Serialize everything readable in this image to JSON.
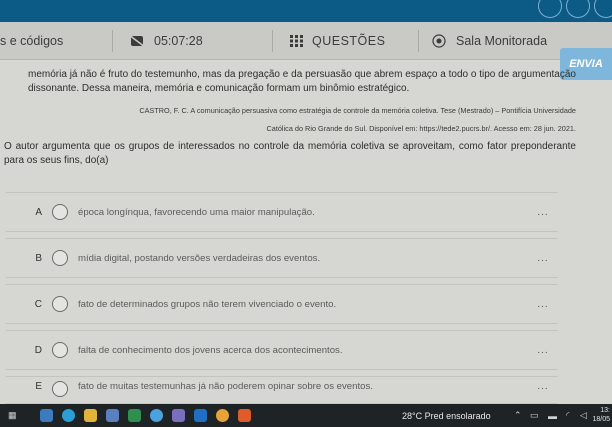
{
  "topbar": {
    "tab_label": "s e códigos",
    "timer": "05:07:28",
    "questions_label": "QUESTÕES",
    "room_label": "Sala Monitorada",
    "send_label": "ENVIA"
  },
  "passage": {
    "text": "memória já não é fruto do testemunho, mas da pregação e da persuasão que abrem espaço a todo o tipo de argumentação dissonante. Dessa maneira, memória e comunicação formam um binômio estratégico.",
    "citation_line1": "CASTRO, F. C. A comunicação persuasiva como estratégia de controle da memória coletiva. Tese (Mestrado) – Pontifícia Universidade",
    "citation_line2": "Católica do Rio Grande do Sul. Disponível em: https://tede2.pucrs.br/. Acesso em: 28 jun. 2021."
  },
  "question": {
    "text": "O autor argumenta que os grupos de interessados no controle da memória coletiva se aproveitam, como fator preponderante para os seus fins, do(a)"
  },
  "options": [
    {
      "letter": "A",
      "text": "época longínqua, favorecendo uma maior manipulação.",
      "more": "..."
    },
    {
      "letter": "B",
      "text": "mídia digital, postando versões verdadeiras dos eventos.",
      "more": "..."
    },
    {
      "letter": "C",
      "text": "fato de determinados grupos não terem vivenciado o evento.",
      "more": "..."
    },
    {
      "letter": "D",
      "text": "falta de conhecimento dos jovens acerca dos acontecimentos.",
      "more": "..."
    },
    {
      "letter": "E",
      "text": "fato de muitas testemunhas já não poderem opinar sobre os eventos.",
      "more": "..."
    }
  ],
  "taskbar": {
    "weather": "28°C  Pred ensolarado",
    "time": "13:",
    "date": "18/05"
  },
  "colors": {
    "top_strip": "#0c5a86",
    "send_button": "#7fb7dc",
    "taskbar": "#1e2326"
  }
}
